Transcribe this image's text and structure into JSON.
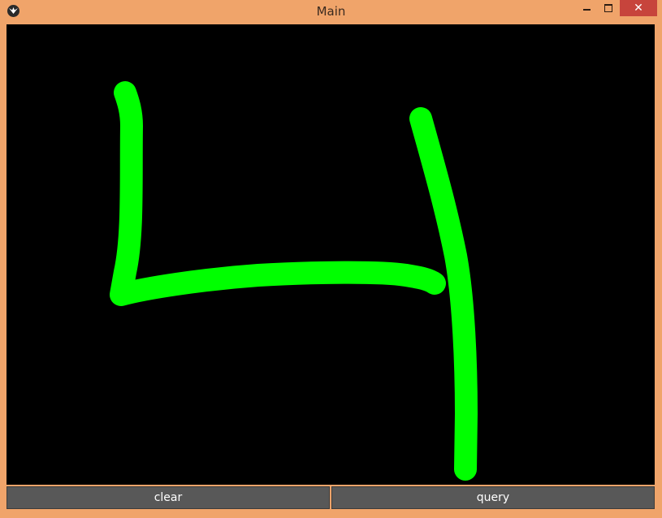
{
  "window": {
    "title": "Main",
    "controls": {
      "minimize_icon": "minimize-icon",
      "maximize_icon": "maximize-icon",
      "close_icon": "close-icon",
      "close_glyph": "✕"
    }
  },
  "canvas": {
    "background": "#000000",
    "stroke_color": "#00ff00",
    "content": "handwritten digit four"
  },
  "buttons": {
    "clear_label": "clear",
    "query_label": "query"
  },
  "colors": {
    "frame": "#f0a46a",
    "close_button": "#c7443c",
    "button_bg": "#585858"
  }
}
